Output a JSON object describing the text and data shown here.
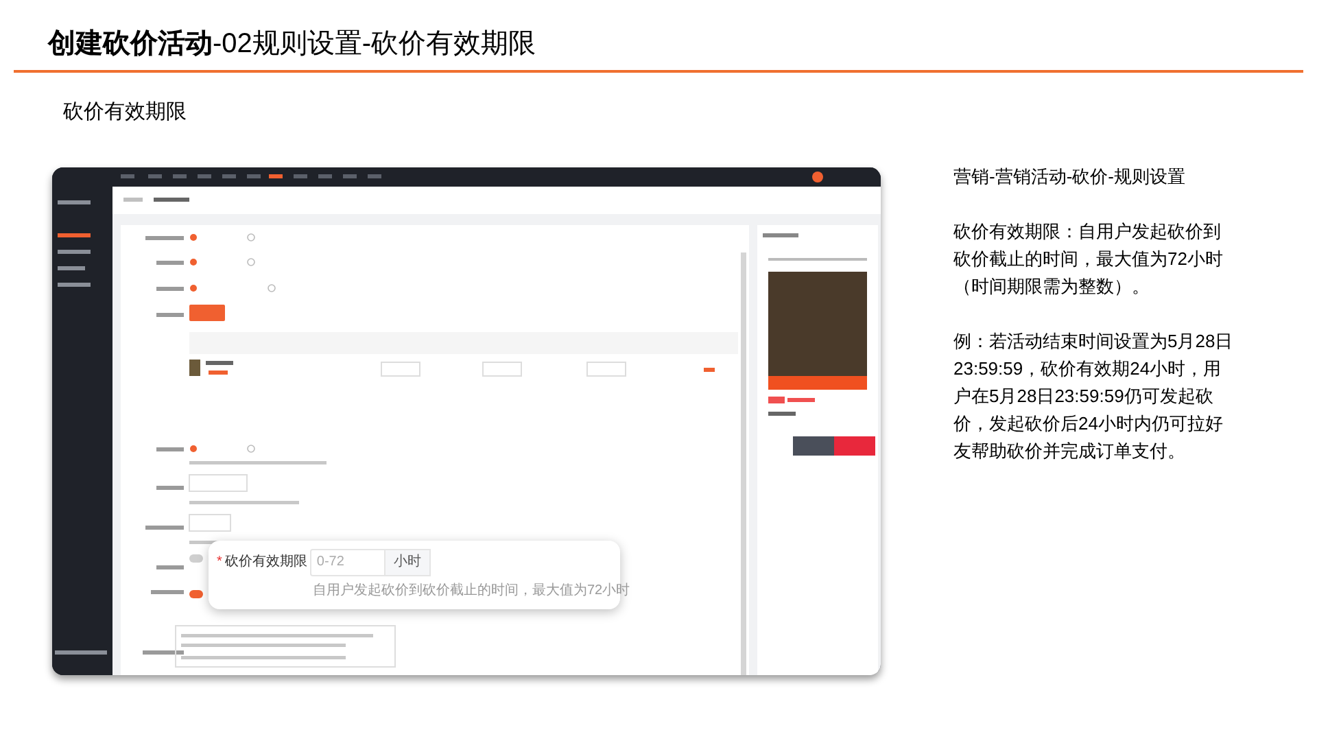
{
  "title": "**创建砍价活动**-02规则设置-砍价有效期限",
  "subtitle": "砍价有效期限",
  "screenshot": {
    "callout": {
      "required_mark": "*",
      "label": "砍价有效期限",
      "placeholder": "0-72",
      "unit": "小时",
      "hint": "自用户发起砍价到砍价截止的时间，最大值为72小时"
    }
  },
  "notes": [
    "营销-营销活动-砍价-规则设置",
    "砍价有效期限：自用户发起砍价到砍价截止的时间，最大值为72小时（时间期限需为整数）。",
    "例：若活动结束时间设置为5月28日23:59:59，砍价有效期24小时，用户在5月28日23:59:59仍可发起砍价，发起砍价后24小时内仍可拉好友帮助砍价并完成订单支付。"
  ]
}
